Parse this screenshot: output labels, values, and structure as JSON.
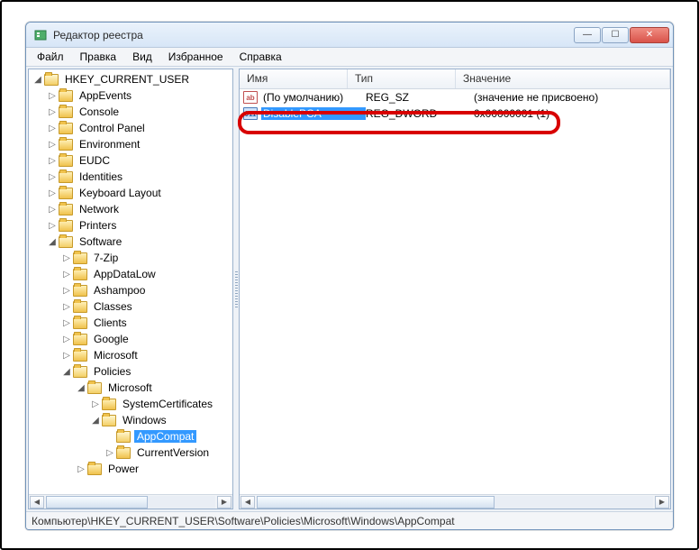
{
  "window": {
    "title": "Редактор реестра"
  },
  "menu": {
    "file": "Файл",
    "edit": "Правка",
    "view": "Вид",
    "favorites": "Избранное",
    "help": "Справка"
  },
  "columns": {
    "name": "Имя",
    "type": "Тип",
    "value": "Значение"
  },
  "values": [
    {
      "name": "(По умолчанию)",
      "type": "REG_SZ",
      "data": "(значение не присвоено)",
      "kind": "sz",
      "selected": false
    },
    {
      "name": "DisablePCA",
      "type": "REG_DWORD",
      "data": "0x00000001 (1)",
      "kind": "dw",
      "selected": true
    }
  ],
  "tree": {
    "root": "HKEY_CURRENT_USER",
    "level2": [
      "AppEvents",
      "Console",
      "Control Panel",
      "Environment",
      "EUDC",
      "Identities",
      "Keyboard Layout",
      "Network",
      "Printers"
    ],
    "software": "Software",
    "level3": [
      "7-Zip",
      "AppDataLow",
      "Ashampoo",
      "Classes",
      "Clients",
      "Google",
      "Microsoft"
    ],
    "policies": "Policies",
    "policies_ms": "Microsoft",
    "syscert": "SystemCertificates",
    "windows": "Windows",
    "appcompat": "AppCompat",
    "curver": "CurrentVersion",
    "power": "Power"
  },
  "statusbar": "Компьютер\\HKEY_CURRENT_USER\\Software\\Policies\\Microsoft\\Windows\\AppCompat"
}
